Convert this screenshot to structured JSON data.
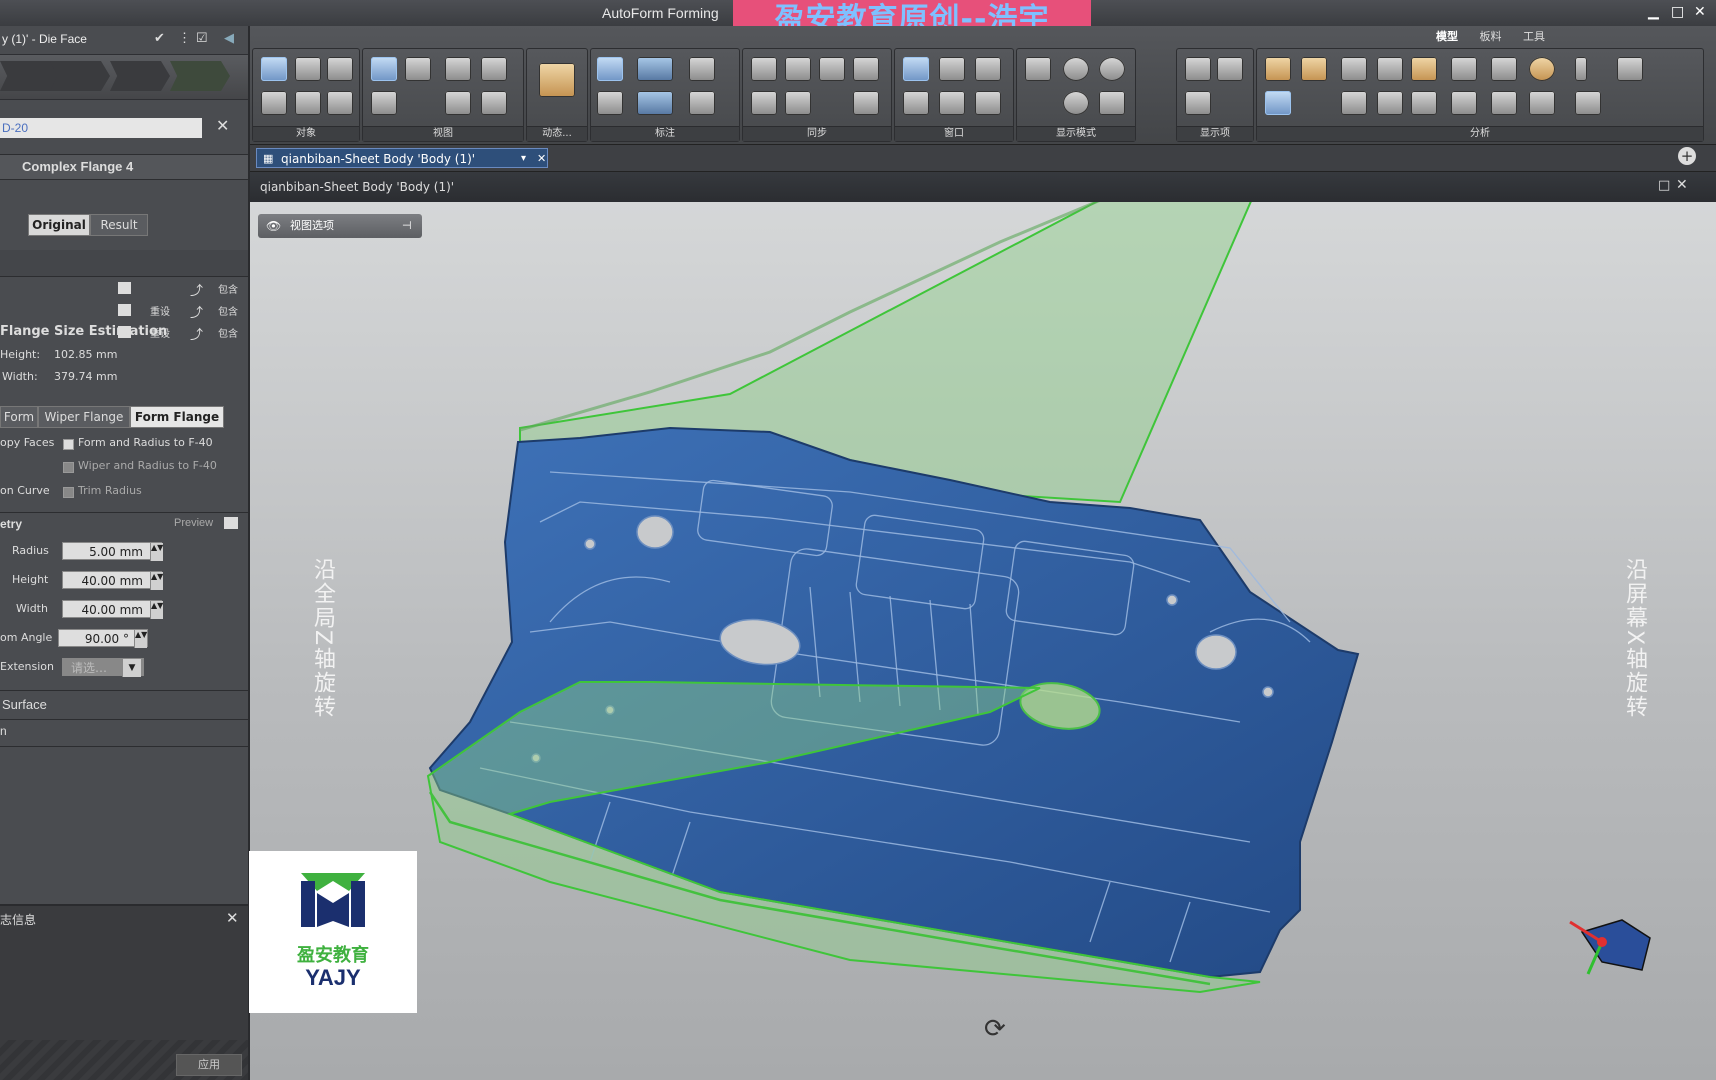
{
  "app": {
    "title": "AutoForm Forming",
    "watermark": "盈安教育原创--浩宇"
  },
  "left_panel": {
    "doc_label": "y (1)' - Die Face",
    "tab_text": "D-20",
    "feature_title": "Complex Flange 4",
    "view_toggle": {
      "original": "Original",
      "result": "Result"
    },
    "rows": [
      {
        "preset": "",
        "include": "包含"
      },
      {
        "preset": "重设",
        "include": "包含"
      },
      {
        "preset": "重设",
        "include": "包含"
      }
    ],
    "estimation": {
      "title": "Flange Size Estimation",
      "height_label": "Height:",
      "height_value": "102.85 mm",
      "width_label": "Width:",
      "width_value": "379.74 mm"
    },
    "flange_tabs": [
      "Form",
      "Wiper Flange",
      "Form Flange"
    ],
    "copy_faces_label": "opy Faces",
    "opt1": "Form and Radius to F-40",
    "opt2": "Wiper and Radius to F-40",
    "on_curve_label": "on Curve",
    "trim_radius": "Trim Radius",
    "geometry": {
      "title": "etry",
      "preview": "Preview"
    },
    "params": [
      {
        "label": "Radius",
        "value": "5.00 mm"
      },
      {
        "label": "Height",
        "value": "40.00 mm"
      },
      {
        "label": "Width",
        "value": "40.00 mm"
      },
      {
        "label": "om Angle",
        "value": "90.00 °"
      }
    ],
    "extension_label": "Extension",
    "extension_value": "请选…",
    "surface_label": "Surface",
    "n_label": "n",
    "log_title": "志信息",
    "bottom_btn": "应用"
  },
  "ribbon": {
    "tabs": [
      "模型",
      "板料",
      "工具"
    ],
    "groups": [
      "对象",
      "视图",
      "动态...",
      "标注",
      "同步",
      "窗口",
      "显示模式",
      "显示项",
      "分析"
    ]
  },
  "doc_tab": "qianbiban-Sheet Body 'Body (1)'",
  "viewport": {
    "title": "qianbiban-Sheet Body 'Body (1)'",
    "view_options": "视图选项",
    "left_note": "沿全局Z轴旋转",
    "right_note": "沿屏幕X轴旋转"
  },
  "logo": {
    "cn": "盈安教育",
    "en": "YAJY"
  },
  "colors": {
    "part_blue": "#2f5e9e",
    "flange_green": "#7cc47a",
    "watermark_bg": "#e7507a"
  }
}
